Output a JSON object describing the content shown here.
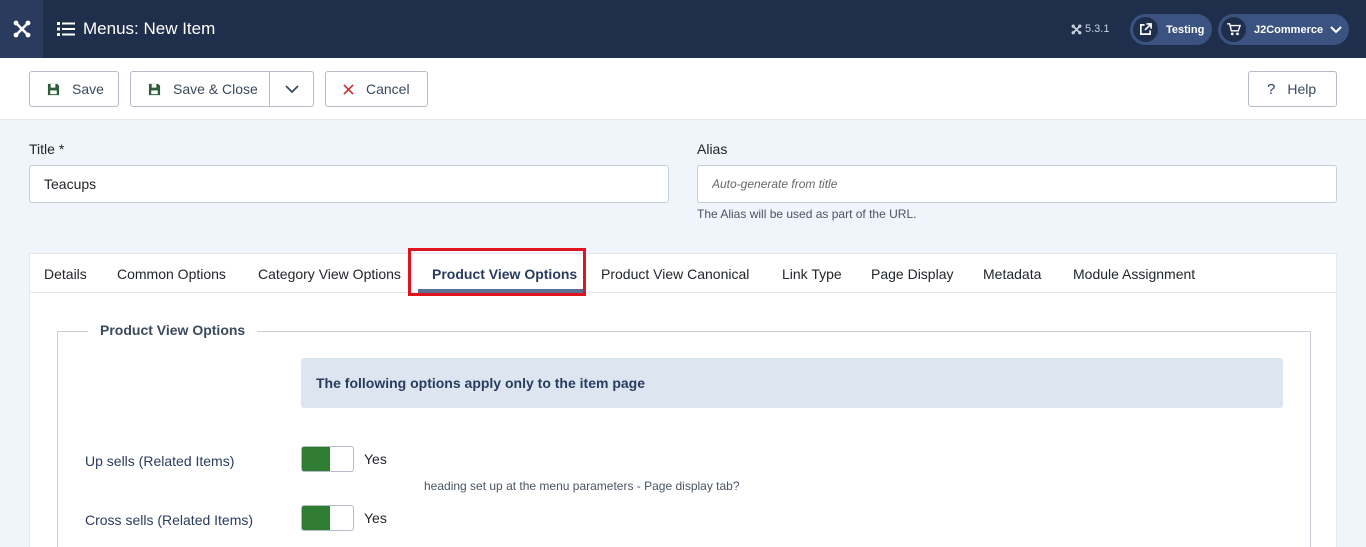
{
  "header": {
    "title": "Menus: New Item",
    "version": "5.3.1",
    "testing_label": "Testing",
    "j2commerce_label": "J2Commerce"
  },
  "toolbar": {
    "save_label": "Save",
    "save_close_label": "Save & Close",
    "cancel_label": "Cancel",
    "help_label": "Help"
  },
  "form": {
    "title_label": "Title *",
    "title_value": "Teacups",
    "alias_label": "Alias",
    "alias_placeholder": "Auto-generate from title",
    "alias_hint": "The Alias will be used as part of the URL."
  },
  "tabs": [
    {
      "label": "Details"
    },
    {
      "label": "Common Options"
    },
    {
      "label": "Category View Options"
    },
    {
      "label": "Product View Options",
      "active": true
    },
    {
      "label": "Product View Canonical"
    },
    {
      "label": "Link Type"
    },
    {
      "label": "Page Display"
    },
    {
      "label": "Metadata"
    },
    {
      "label": "Module Assignment"
    }
  ],
  "panel": {
    "legend": "Product View Options",
    "alert": "The following options apply only to the item page",
    "options": [
      {
        "label": "Up sells (Related Items)",
        "value": "Yes",
        "description": "heading set up at the menu parameters - Page display tab?"
      },
      {
        "label": "Cross sells (Related Items)",
        "value": "Yes"
      }
    ]
  },
  "colors": {
    "header_bg": "#1f2e4b",
    "accent": "#2a3c5e",
    "toggle_on": "#2f7d32",
    "highlight": "#e0141e"
  }
}
